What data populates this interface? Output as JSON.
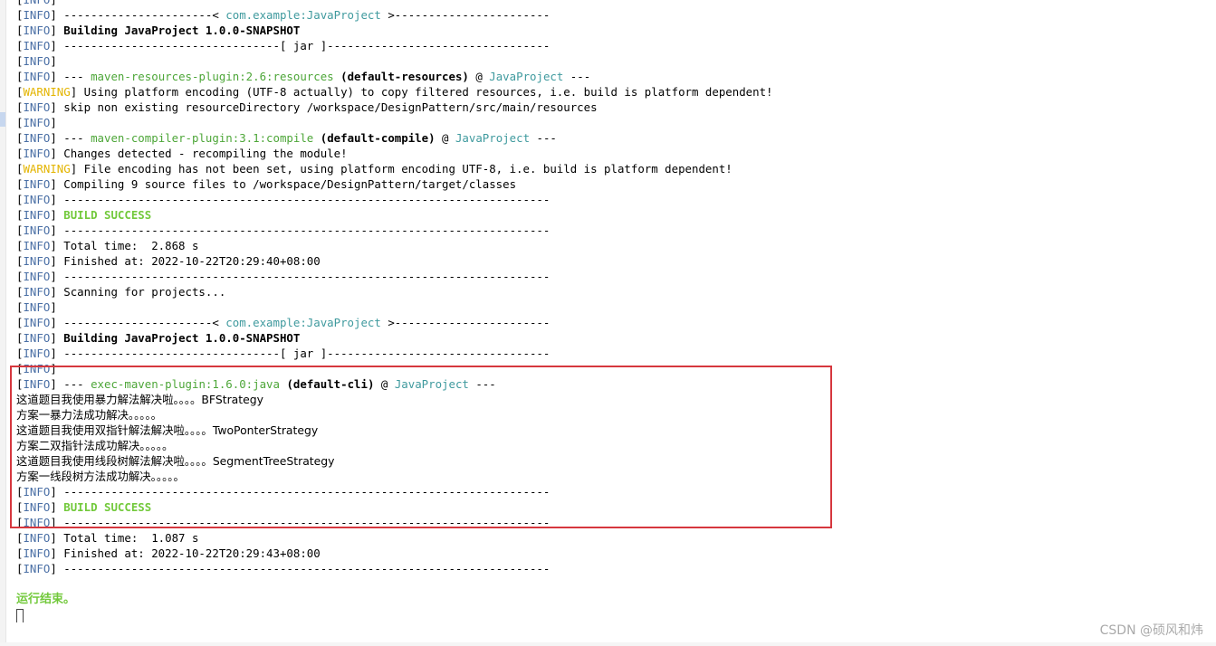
{
  "console": {
    "info_tag": "INFO",
    "warning_tag": "WARNING",
    "lines": [
      {
        "tag": "INFO",
        "segments": [
          {
            "text": ""
          }
        ]
      },
      {
        "tag": "INFO",
        "segments": [
          {
            "text": " ----------------------< "
          },
          {
            "text": "com.example:JavaProject",
            "style": "proj"
          },
          {
            "text": " >-----------------------"
          }
        ]
      },
      {
        "tag": "INFO",
        "segments": [
          {
            "text": " "
          },
          {
            "text": "Building JavaProject 1.0.0-SNAPSHOT",
            "style": "bold"
          }
        ]
      },
      {
        "tag": "INFO",
        "segments": [
          {
            "text": " --------------------------------[ jar ]---------------------------------"
          }
        ]
      },
      {
        "tag": "INFO",
        "segments": [
          {
            "text": ""
          }
        ]
      },
      {
        "tag": "INFO",
        "segments": [
          {
            "text": " --- "
          },
          {
            "text": "maven-resources-plugin:2.6:resources",
            "style": "plugin"
          },
          {
            "text": " "
          },
          {
            "text": "(default-resources)",
            "style": "goal"
          },
          {
            "text": " @ "
          },
          {
            "text": "JavaProject",
            "style": "proj"
          },
          {
            "text": " ---"
          }
        ]
      },
      {
        "tag": "WARNING",
        "segments": [
          {
            "text": " Using platform encoding (UTF-8 actually) to copy filtered resources, i.e. build is platform dependent!"
          }
        ]
      },
      {
        "tag": "INFO",
        "segments": [
          {
            "text": " skip non existing resourceDirectory /workspace/DesignPattern/src/main/resources"
          }
        ]
      },
      {
        "tag": "INFO",
        "segments": [
          {
            "text": ""
          }
        ]
      },
      {
        "tag": "INFO",
        "segments": [
          {
            "text": " --- "
          },
          {
            "text": "maven-compiler-plugin:3.1:compile",
            "style": "plugin"
          },
          {
            "text": " "
          },
          {
            "text": "(default-compile)",
            "style": "goal"
          },
          {
            "text": " @ "
          },
          {
            "text": "JavaProject",
            "style": "proj"
          },
          {
            "text": " ---"
          }
        ]
      },
      {
        "tag": "INFO",
        "segments": [
          {
            "text": " Changes detected - recompiling the module!"
          }
        ]
      },
      {
        "tag": "WARNING",
        "segments": [
          {
            "text": " File encoding has not been set, using platform encoding UTF-8, i.e. build is platform dependent!"
          }
        ]
      },
      {
        "tag": "INFO",
        "segments": [
          {
            "text": " Compiling 9 source files to /workspace/DesignPattern/target/classes"
          }
        ]
      },
      {
        "tag": "INFO",
        "segments": [
          {
            "text": " ------------------------------------------------------------------------"
          }
        ]
      },
      {
        "tag": "INFO",
        "segments": [
          {
            "text": " "
          },
          {
            "text": "BUILD SUCCESS",
            "style": "success"
          }
        ]
      },
      {
        "tag": "INFO",
        "segments": [
          {
            "text": " ------------------------------------------------------------------------"
          }
        ]
      },
      {
        "tag": "INFO",
        "segments": [
          {
            "text": " Total time:  2.868 s"
          }
        ]
      },
      {
        "tag": "INFO",
        "segments": [
          {
            "text": " Finished at: 2022-10-22T20:29:40+08:00"
          }
        ]
      },
      {
        "tag": "INFO",
        "segments": [
          {
            "text": " ------------------------------------------------------------------------"
          }
        ]
      },
      {
        "tag": "INFO",
        "segments": [
          {
            "text": " Scanning for projects..."
          }
        ]
      },
      {
        "tag": "INFO",
        "segments": [
          {
            "text": ""
          }
        ]
      },
      {
        "tag": "INFO",
        "segments": [
          {
            "text": " ----------------------< "
          },
          {
            "text": "com.example:JavaProject",
            "style": "proj"
          },
          {
            "text": " >-----------------------"
          }
        ]
      },
      {
        "tag": "INFO",
        "segments": [
          {
            "text": " "
          },
          {
            "text": "Building JavaProject 1.0.0-SNAPSHOT",
            "style": "bold"
          }
        ]
      },
      {
        "tag": "INFO",
        "segments": [
          {
            "text": " --------------------------------[ jar ]---------------------------------"
          }
        ]
      },
      {
        "tag": "INFO",
        "segments": [
          {
            "text": ""
          }
        ]
      },
      {
        "tag": "INFO",
        "segments": [
          {
            "text": " --- "
          },
          {
            "text": "exec-maven-plugin:1.6.0:java",
            "style": "plugin"
          },
          {
            "text": " "
          },
          {
            "text": "(default-cli)",
            "style": "goal"
          },
          {
            "text": " @ "
          },
          {
            "text": "JavaProject",
            "style": "proj"
          },
          {
            "text": " ---"
          }
        ]
      },
      {
        "tag": "",
        "segments": [
          {
            "text": "这道题目我使用暴力解法解决啦。。。。BFStrategy",
            "style": "cjk"
          }
        ]
      },
      {
        "tag": "",
        "segments": [
          {
            "text": "方案一暴力法成功解决。。。。。",
            "style": "cjk"
          }
        ]
      },
      {
        "tag": "",
        "segments": [
          {
            "text": "这道题目我使用双指针解法解决啦。。。。TwoPonterStrategy",
            "style": "cjk"
          }
        ]
      },
      {
        "tag": "",
        "segments": [
          {
            "text": "方案二双指针法成功解决。。。。。",
            "style": "cjk"
          }
        ]
      },
      {
        "tag": "",
        "segments": [
          {
            "text": "这道题目我使用线段树解法解决啦。。。。SegmentTreeStrategy",
            "style": "cjk"
          }
        ]
      },
      {
        "tag": "",
        "segments": [
          {
            "text": "方案一线段树方法成功解决。。。。。",
            "style": "cjk"
          }
        ]
      },
      {
        "tag": "INFO",
        "segments": [
          {
            "text": " ------------------------------------------------------------------------"
          }
        ]
      },
      {
        "tag": "INFO",
        "segments": [
          {
            "text": " "
          },
          {
            "text": "BUILD SUCCESS",
            "style": "success"
          }
        ]
      },
      {
        "tag": "INFO",
        "segments": [
          {
            "text": " ------------------------------------------------------------------------"
          }
        ]
      },
      {
        "tag": "INFO",
        "segments": [
          {
            "text": " Total time:  1.087 s"
          }
        ]
      },
      {
        "tag": "INFO",
        "segments": [
          {
            "text": " Finished at: 2022-10-22T20:29:43+08:00"
          }
        ]
      },
      {
        "tag": "INFO",
        "segments": [
          {
            "text": " ------------------------------------------------------------------------"
          }
        ]
      }
    ],
    "run_finished": "运行结束。"
  },
  "colors": {
    "info_tag": "#4a6fa5",
    "warning_tag": "#e3b400",
    "plugin": "#4da638",
    "project": "#3f9a9e",
    "success": "#72c93b",
    "highlight_box": "#d6373e"
  },
  "watermark": "CSDN @硕风和炜"
}
